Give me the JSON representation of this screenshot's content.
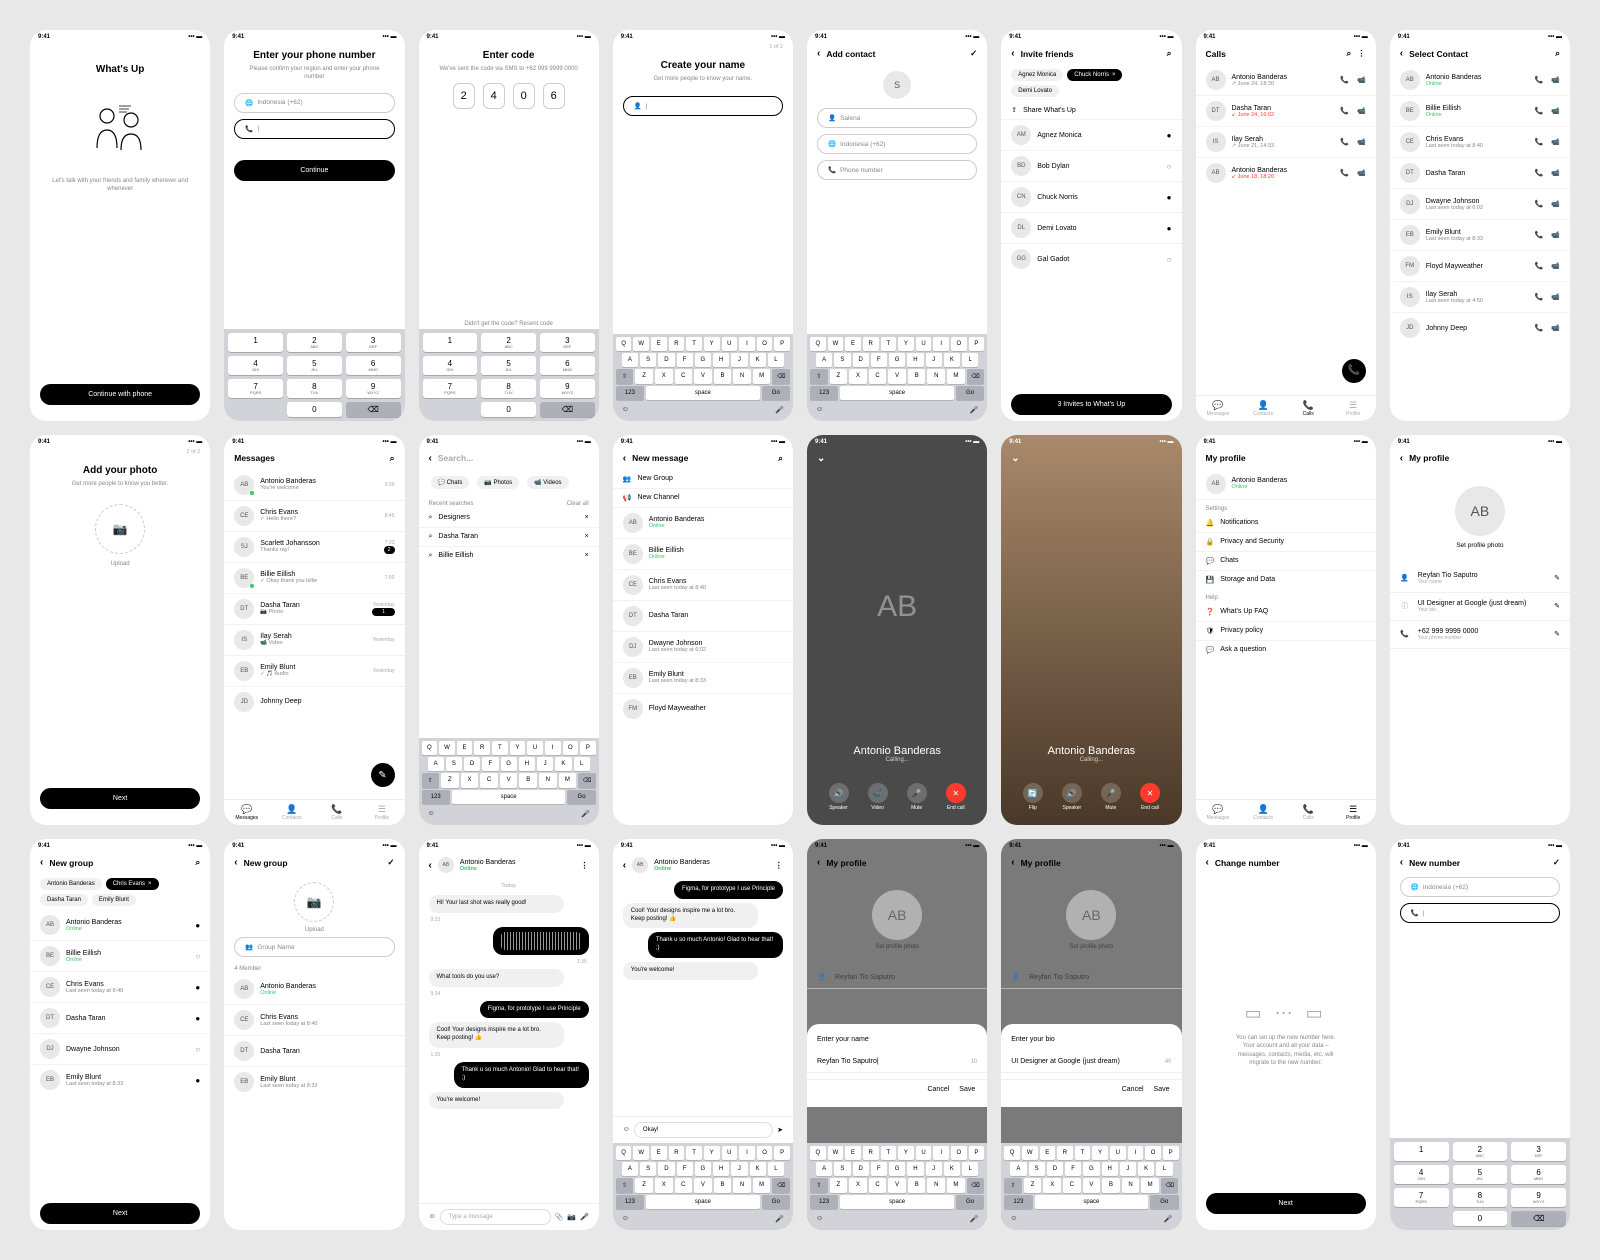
{
  "status_time": "9:41",
  "app_name": "What's Up",
  "s1": {
    "tagline": "Let's talk with your friends and family wherever and whenever",
    "cta": "Continue with phone"
  },
  "s2": {
    "title": "Enter your phone number",
    "sub": "Please confirm your region and enter your phone number",
    "region": "Indonesia (+62)",
    "cta": "Continue"
  },
  "s3": {
    "title": "Enter code",
    "sub": "We've sent the code via SMS to +62 999 9999 0000",
    "code": [
      "2",
      "4",
      "0",
      "6"
    ],
    "resend": "Didn't get the code? Resent code"
  },
  "s4": {
    "step": "1 of 2",
    "title": "Create your name",
    "sub": "Get more people to know your name."
  },
  "s5": {
    "title": "Add contact",
    "name_ph": "Salena",
    "region": "Indonesia (+62)",
    "phone_ph": "Phone number",
    "avatar": "S"
  },
  "s6": {
    "title": "Invite friends",
    "selected": [
      {
        "n": "Agnez Monica"
      },
      {
        "n": "Chuck Norris",
        "x": true
      }
    ],
    "extra": "Demi Lovato",
    "share": "Share What's Up",
    "list": [
      {
        "i": "AM",
        "n": "Agnez Monica",
        "c": true
      },
      {
        "i": "BD",
        "n": "Bob Dylan"
      },
      {
        "i": "CN",
        "n": "Chuck Norris",
        "c": true
      },
      {
        "i": "DL",
        "n": "Demi Lovato",
        "c": true
      },
      {
        "i": "GG",
        "n": "Gal Gadot"
      }
    ],
    "cta": "3 Invites to What's Up"
  },
  "s7": {
    "title": "Calls",
    "list": [
      {
        "i": "AB",
        "n": "Antonio Banderas",
        "s": "↗ June 24, 18:30"
      },
      {
        "i": "DT",
        "n": "Dasha Taran",
        "s": "↙ June 24, 16:02",
        "red": true
      },
      {
        "i": "IS",
        "n": "Ilay Serah",
        "s": "↗ June 21, 14:33"
      },
      {
        "i": "AB",
        "n": "Antonio Banderas",
        "s": "↙ June 18, 18:20",
        "red": true
      }
    ]
  },
  "s8": {
    "title": "Select Contact",
    "list": [
      {
        "i": "AB",
        "n": "Antonio Banderas",
        "s": "Online",
        "on": true
      },
      {
        "i": "BE",
        "n": "Billie Eillish",
        "s": "Online",
        "on": true
      },
      {
        "i": "CE",
        "n": "Chris Evans",
        "s": "Last seen today at 8:40"
      },
      {
        "i": "DT",
        "n": "Dasha Taran"
      },
      {
        "i": "DJ",
        "n": "Dwayne Johnson",
        "s": "Last seen today at 6:02"
      },
      {
        "i": "EB",
        "n": "Emily Blunt",
        "s": "Last seen today at 8:33"
      },
      {
        "i": "FM",
        "n": "Floyd Mayweather"
      },
      {
        "i": "IS",
        "n": "Ilay Serah",
        "s": "Last seen today at 4:50"
      },
      {
        "i": "JD",
        "n": "Johnny Deep"
      }
    ]
  },
  "s9": {
    "step": "2 of 2",
    "title": "Add your photo",
    "sub": "Get more people to know you better.",
    "upload": "Upload",
    "cta": "Next"
  },
  "s10": {
    "title": "Messages",
    "list": [
      {
        "i": "AB",
        "n": "Antonio Banderas",
        "s": "You're welcome",
        "t": "9:39",
        "dot": true
      },
      {
        "i": "CE",
        "n": "Chris Evans",
        "s": "✓ Hello there?",
        "t": "8:45"
      },
      {
        "i": "SJ",
        "n": "Scarlett Johansson",
        "s": "Thanks ray!",
        "t": "7:03",
        "b": "2"
      },
      {
        "i": "BE",
        "n": "Billie Eillish",
        "s": "✓ Okay thank you billie",
        "t": "7:00",
        "dot": true
      },
      {
        "i": "DT",
        "n": "Dasha Taran",
        "s": "📷 Photo",
        "t": "Yesterday",
        "b": "1"
      },
      {
        "i": "IS",
        "n": "Ilay Serah",
        "s": "📹 Video",
        "t": "Yesterday"
      },
      {
        "i": "EB",
        "n": "Emily Blunt",
        "s": "✓ 🎵 Audio",
        "t": "Yesterday"
      },
      {
        "i": "JD",
        "n": "Johnny Deep",
        "t": ""
      }
    ]
  },
  "s11": {
    "search_ph": "Search...",
    "chips": [
      "Chats",
      "Photos",
      "Videos"
    ],
    "recent_hdr": "Recent searches",
    "clear": "Clear all",
    "recent": [
      "Designers",
      "Dasha Taran",
      "Billie Eillish"
    ]
  },
  "s12": {
    "title": "New message",
    "opts": [
      "New Group",
      "New Channel"
    ],
    "list": [
      {
        "i": "AB",
        "n": "Antonio Banderas",
        "s": "Online",
        "on": true
      },
      {
        "i": "BE",
        "n": "Billie Eillish",
        "s": "Online",
        "on": true
      },
      {
        "i": "CE",
        "n": "Chris Evans",
        "s": "Last seen today at 8:40"
      },
      {
        "i": "DT",
        "n": "Dasha Taran"
      },
      {
        "i": "DJ",
        "n": "Dwayne Johnson",
        "s": "Last seen today at 6:02"
      },
      {
        "i": "EB",
        "n": "Emily Blunt",
        "s": "Last seen today at 8:33"
      },
      {
        "i": "FM",
        "n": "Floyd Mayweather"
      }
    ]
  },
  "call": {
    "name": "Antonio Banderas",
    "status": "Calling...",
    "btns": [
      "Speaker",
      "Video",
      "Mute",
      "End call"
    ],
    "btns2": [
      "Flip",
      "Speaker",
      "Mute",
      "End call"
    ]
  },
  "s15": {
    "title": "My profile",
    "name": "Antonio Banderas",
    "status": "Online",
    "set_hdr": "Settings",
    "settings": [
      "Notifications",
      "Privacy and Security",
      "Chats",
      "Storage and Data"
    ],
    "help_hdr": "Help",
    "help": [
      "What's Up FAQ",
      "Privacy policy",
      "Ask a question"
    ]
  },
  "s16": {
    "title": "My profile",
    "set_photo": "Set profile photo",
    "rows": [
      {
        "l": "Reyfan Tio Saputro",
        "s": "Your name"
      },
      {
        "l": "UI Designer at Google (just dream)",
        "s": "Your bio"
      },
      {
        "l": "+62 999 9999 0000",
        "s": "Your phone number"
      }
    ]
  },
  "s17": {
    "title": "New group",
    "selected": [
      {
        "n": "Antonio Banderas"
      },
      {
        "n": "Chris Evans",
        "x": true
      }
    ],
    "extra": [
      "Dasha Taran",
      "Emily Blunt"
    ],
    "list": [
      {
        "i": "AB",
        "n": "Antonio Banderas",
        "s": "Online",
        "on": true,
        "c": true
      },
      {
        "i": "BE",
        "n": "Billie Eillish",
        "s": "Online",
        "on": true
      },
      {
        "i": "CE",
        "n": "Chris Evans",
        "s": "Last seen today at 8:40",
        "c": true
      },
      {
        "i": "DT",
        "n": "Dasha Taran",
        "c": true
      },
      {
        "i": "DJ",
        "n": "Dwayne Johnson"
      },
      {
        "i": "EB",
        "n": "Emily Blunt",
        "s": "Last seen today at 8:33",
        "c": true
      }
    ],
    "cta": "Next"
  },
  "s18": {
    "title": "New group",
    "upload": "Upload",
    "name_ph": "Group Name",
    "member_hdr": "4 Member",
    "list": [
      {
        "i": "AB",
        "n": "Antonio Banderas",
        "s": "Online",
        "on": true
      },
      {
        "i": "CE",
        "n": "Chris Evans",
        "s": "Last seen today at 8:40"
      },
      {
        "i": "DT",
        "n": "Dasha Taran"
      },
      {
        "i": "EB",
        "n": "Emily Blunt",
        "s": "Last seen today at 8:33"
      }
    ]
  },
  "chat": {
    "name": "Antonio Banderas",
    "status": "Online",
    "day": "Today",
    "m1": "Hi! Your last shot was really good!",
    "t1": "9:33",
    "m3": "What tools do you use?",
    "t3": "9:34",
    "m4": "Figma, for prototype I use Principle",
    "m5": "Cool! Your designs inspire me a lot bro. Keep posting! 👍",
    "t5": "1:35",
    "m6": "Thank u so much Antonio! Glad to hear that! ;)",
    "m7": "You're welcome!",
    "typing": "Type a message"
  },
  "s20": {
    "m1": "Figma, for prototype I use Principle",
    "m2": "Cool! Your designs inspire me a lot bro. Keep posting! 👍",
    "m3": "Thank u so much Antonio! Glad to hear that! ;)",
    "m4": "You're welcome!",
    "reply": "Okay!"
  },
  "s21": {
    "title": "My profile",
    "sheet": "Enter your name",
    "val": "Reyfan Tio Saputro|",
    "count": "10",
    "cancel": "Cancel",
    "save": "Save"
  },
  "s22": {
    "title": "My profile",
    "sheet": "Enter your bio",
    "val": "UI Designer at Google (just dream)",
    "count": "40",
    "cancel": "Cancel",
    "save": "Save"
  },
  "s23": {
    "title": "Change number",
    "desc": "You can set up the new number here. Your account and all your data – messages, contacts, media, etc. will migrate to the new number.",
    "cta": "Next"
  },
  "s24": {
    "title": "New number",
    "region": "Indonesia (+62)"
  },
  "tabs": [
    "Messages",
    "Contacts",
    "Calls",
    "Profile"
  ],
  "qwerty_r1": [
    "Q",
    "W",
    "E",
    "R",
    "T",
    "Y",
    "U",
    "I",
    "O",
    "P"
  ],
  "qwerty_r2": [
    "A",
    "S",
    "D",
    "F",
    "G",
    "H",
    "J",
    "K",
    "L"
  ],
  "qwerty_r3": [
    "Z",
    "X",
    "C",
    "V",
    "B",
    "N",
    "M"
  ],
  "keypad": [
    [
      "1",
      ""
    ],
    [
      "2",
      "ABC"
    ],
    [
      "3",
      "DEF"
    ],
    [
      "4",
      "GHI"
    ],
    [
      "5",
      "JKL"
    ],
    [
      "6",
      "MNO"
    ],
    [
      "7",
      "PQRS"
    ],
    [
      "8",
      "TUV"
    ],
    [
      "9",
      "WXYZ"
    ]
  ],
  "kb_space": "space",
  "kb_go": "Go",
  "kb_123": "123"
}
